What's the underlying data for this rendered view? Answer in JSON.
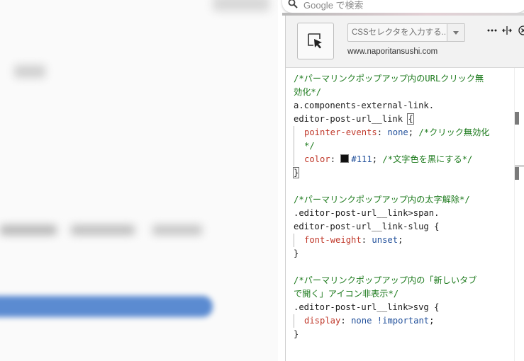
{
  "browser": {
    "search_placeholder": "Google で検索"
  },
  "devtools": {
    "selector_placeholder": "CSSセレクタを入力する...",
    "site_url": "www.naporitansushi.com",
    "icons": [
      "cursor-select-icon",
      "chevron-down-icon",
      "more-icon",
      "split-view-icon",
      "close-icon"
    ]
  },
  "code": {
    "block1": {
      "comment_a": "/*パーマリンクポップアップ内のURLクリック無",
      "comment_b": "効化*/",
      "selector_a": "a.components-external-link.",
      "selector_b": "editor-post-url__link ",
      "open": "{",
      "decl1_prop": "pointer-events",
      "decl1_val": "none",
      "decl1_comment_a": "/*クリック無効化",
      "decl1_comment_b": "*/",
      "decl2_prop": "color",
      "decl2_val": "#111",
      "decl2_comment": "/*文字色を黒にする*/",
      "close": "}"
    },
    "block2": {
      "comment": "/*パーマリンクポップアップ内の太字解除*/",
      "selector_a": ".editor-post-url__link>span.",
      "selector_b": "editor-post-url__link-slug {",
      "decl_prop": "font-weight",
      "decl_val": "unset",
      "close": "}"
    },
    "block3": {
      "comment_a": "/*パーマリンクポップアップ内の「新しいタブ",
      "comment_b": "で開く」アイコン非表示*/",
      "selector": ".editor-post-url__link>svg {",
      "decl_prop": "display",
      "decl_val": "none",
      "decl_important": "!important",
      "close": "}"
    }
  },
  "colors": {
    "comment": "#1c7a1c",
    "property": "#c0392b",
    "value": "#24529c",
    "swatch": "#111111"
  }
}
